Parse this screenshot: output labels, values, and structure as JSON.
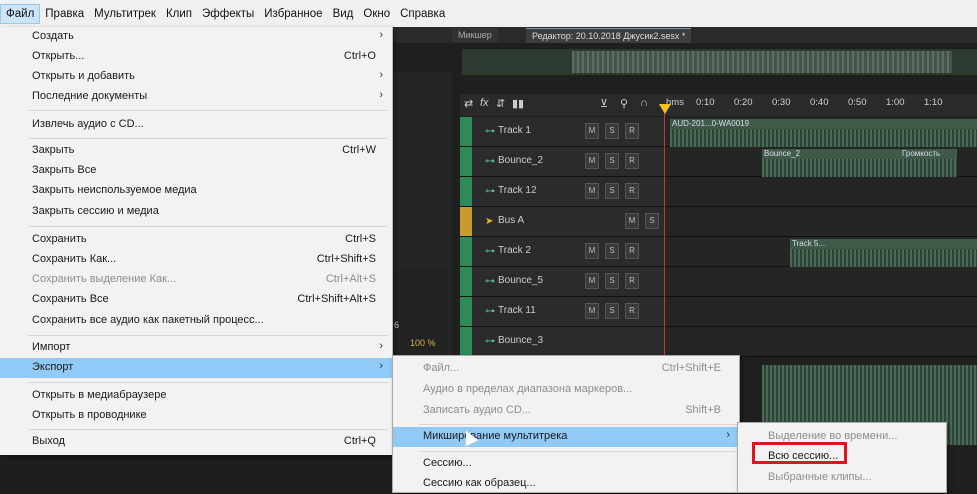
{
  "menubar": {
    "items": [
      "Файл",
      "Правка",
      "Мультитрек",
      "Клип",
      "Эффекты",
      "Избранное",
      "Вид",
      "Окно",
      "Справка"
    ]
  },
  "editor": {
    "tabs": [
      "Микшер",
      "Редактор: 20.10.2018 Джусик2.sesx *"
    ],
    "ruler": [
      "hms",
      "0:10",
      "0:20",
      "0:30",
      "0:40",
      "0:50",
      "1:00",
      "1:10"
    ],
    "tracks": [
      {
        "name": "Track 1",
        "kind": "audio",
        "clip_label": "AUD-201...0-WA0019"
      },
      {
        "name": "Bounce_2",
        "kind": "audio",
        "clip_label": "Bounce_2"
      },
      {
        "name": "Track 12",
        "kind": "audio",
        "clip_label": ""
      },
      {
        "name": "Bus A",
        "kind": "bus",
        "clip_label": ""
      },
      {
        "name": "Track 2",
        "kind": "audio",
        "clip_label": "Track 5..."
      },
      {
        "name": "Bounce_5",
        "kind": "audio",
        "clip_label": ""
      },
      {
        "name": "Track 11",
        "kind": "audio",
        "clip_label": ""
      },
      {
        "name": "Bounce_3",
        "kind": "audio",
        "clip_label": ""
      }
    ],
    "button_m": "M",
    "button_s": "S",
    "button_r": "R",
    "zoom_readout": "100 %",
    "clip_extra_label": "Громкость",
    "volume_readout": "6"
  },
  "file_menu": {
    "items": [
      {
        "label": "Создать",
        "shortcut": "",
        "submenu": true,
        "disabled": false
      },
      {
        "label": "Открыть...",
        "shortcut": "Ctrl+O",
        "submenu": false,
        "disabled": false
      },
      {
        "label": "Открыть и добавить",
        "shortcut": "",
        "submenu": true,
        "disabled": false
      },
      {
        "label": "Последние документы",
        "shortcut": "",
        "submenu": true,
        "disabled": false
      },
      {
        "label": "Извлечь аудио с CD...",
        "shortcut": "",
        "submenu": false,
        "disabled": false
      },
      {
        "label": "Закрыть",
        "shortcut": "Ctrl+W",
        "submenu": false,
        "disabled": false
      },
      {
        "label": "Закрыть Все",
        "shortcut": "",
        "submenu": false,
        "disabled": false
      },
      {
        "label": "Закрыть неиспользуемое медиа",
        "shortcut": "",
        "submenu": false,
        "disabled": false
      },
      {
        "label": "Закрыть сессию и медиа",
        "shortcut": "",
        "submenu": false,
        "disabled": false
      },
      {
        "label": "Сохранить",
        "shortcut": "Ctrl+S",
        "submenu": false,
        "disabled": false
      },
      {
        "label": "Сохранить Как...",
        "shortcut": "Ctrl+Shift+S",
        "submenu": false,
        "disabled": false
      },
      {
        "label": "Сохранить выделение Как...",
        "shortcut": "Ctrl+Alt+S",
        "submenu": false,
        "disabled": true
      },
      {
        "label": "Сохранить Все",
        "shortcut": "Ctrl+Shift+Alt+S",
        "submenu": false,
        "disabled": false
      },
      {
        "label": "Сохранить все аудио как пакетный процесс...",
        "shortcut": "",
        "submenu": false,
        "disabled": false
      },
      {
        "label": "Импорт",
        "shortcut": "",
        "submenu": true,
        "disabled": false
      },
      {
        "label": "Экспорт",
        "shortcut": "",
        "submenu": true,
        "disabled": false,
        "highlighted": true
      },
      {
        "label": "Открыть в медиабраузере",
        "shortcut": "",
        "submenu": false,
        "disabled": false
      },
      {
        "label": "Открыть в проводнике",
        "shortcut": "",
        "submenu": false,
        "disabled": false
      },
      {
        "label": "Выход",
        "shortcut": "Ctrl+Q",
        "submenu": false,
        "disabled": false
      }
    ]
  },
  "export_menu": {
    "items": [
      {
        "label": "Файл...",
        "shortcut": "Ctrl+Shift+E",
        "disabled": true
      },
      {
        "label": "Аудио в пределах диапазона маркеров...",
        "shortcut": "",
        "disabled": true
      },
      {
        "label": "Записать аудио CD...",
        "shortcut": "Shift+B",
        "disabled": true
      },
      {
        "label": "Микширование мультитрека",
        "shortcut": "",
        "disabled": false,
        "submenu": true,
        "highlighted": true
      },
      {
        "label": "Сессию...",
        "shortcut": "",
        "disabled": false
      },
      {
        "label": "Сессию как образец...",
        "shortcut": "",
        "disabled": false
      }
    ]
  },
  "mixdown_menu": {
    "items": [
      {
        "label": "Выделение во времени...",
        "disabled": true
      },
      {
        "label": "Всю сессию...",
        "disabled": false,
        "highlighted_box": true
      },
      {
        "label": "Выбранные клипы...",
        "disabled": true
      }
    ]
  },
  "colors": {
    "menu_highlight": "#91c9f7",
    "red_box": "#e0141e",
    "track_green": "#2f8a5a",
    "bus_gold": "#c89b2a",
    "playhead": "#c7372f"
  }
}
